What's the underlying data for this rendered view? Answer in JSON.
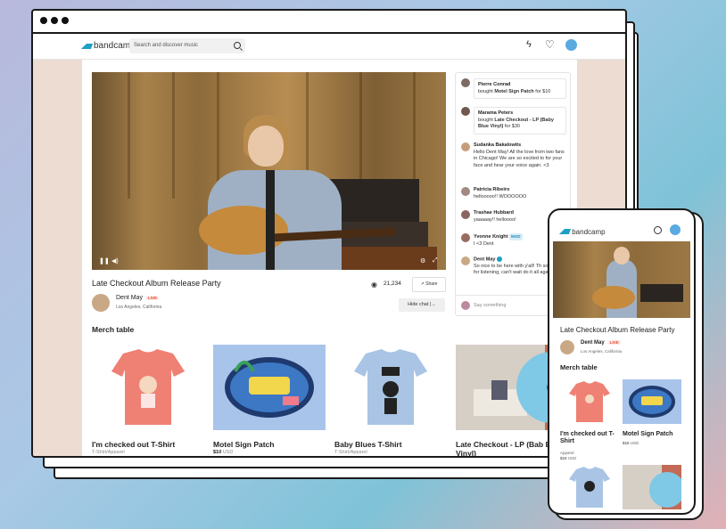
{
  "app": {
    "logo": "bandcamp",
    "search_placeholder": "Search and discover music"
  },
  "stream": {
    "title": "Late Checkout Album Release Party",
    "viewers": "21,234",
    "share_label": "Share",
    "artist": "Dent May",
    "live_label": "LIVE",
    "location": "Los Angeles, California",
    "hide_chat_label": "Hide chat"
  },
  "chat": {
    "messages": [
      {
        "name": "Pierre Conrad",
        "line1": "bought",
        "item": "Motel Sign Patch",
        "line2": "for $10"
      },
      {
        "name": "Marama Peters",
        "line1": "bought",
        "item": "Late Checkout - LP (Baby Blue Vinyl)",
        "line2": "for $30"
      },
      {
        "name": "Sudanka Bakalowits",
        "text": "Hello Dent May! All the love from two fans in Chicago! We are so excited to for your face and hear your voice again. <3"
      },
      {
        "name": "Patricia Ribeiro",
        "text": "hellooooo!! WOOOOOO"
      },
      {
        "name": "Trashae Hubbard",
        "text": "yaaaaay!! helloooo!"
      },
      {
        "name": "Yvonne Knight",
        "badge": "MOD",
        "text": "I <3 Dent"
      },
      {
        "name": "Dent May",
        "text": "So nice to be here with y'all! Th so much for listening, can't wait do it all again!"
      }
    ],
    "input_placeholder": "Say something"
  },
  "merch": {
    "heading": "Merch table",
    "items": [
      {
        "name": "I'm checked out T-Shirt",
        "sub": "T-Shirt/Apparel",
        "price": ""
      },
      {
        "name": "Motel Sign Patch",
        "sub": "",
        "price": "$10",
        "currency": "USD"
      },
      {
        "name": "Baby Blues T-Shirt",
        "sub": "T-Shirt/Apparel",
        "price": ""
      },
      {
        "name": "Late Checkout - LP (Bab Blue Vinyl)",
        "sub": "",
        "price": ""
      }
    ]
  },
  "phone": {
    "logo": "bandcamp",
    "title": "Late Checkout Album Release Party",
    "artist": "Dent May",
    "live_label": "LIVE",
    "location": "Los Angeles, California",
    "merch_heading": "Merch table",
    "item1_name": "I'm checked out T-Shirt",
    "item1_sub": "Apparel",
    "item1_price": "$10",
    "item1_currency": "USD",
    "item2_name": "Motel Sign Patch",
    "item2_price": "$10",
    "item2_currency": "USD"
  },
  "colors": {
    "brand": "#1da0c3",
    "live": "#e04e39"
  },
  "icons": [
    "search-icon",
    "bolt-icon",
    "heart-icon",
    "eye-icon",
    "share-icon",
    "play-pause-icon",
    "volume-icon",
    "fullscreen-icon",
    "verified-icon"
  ]
}
